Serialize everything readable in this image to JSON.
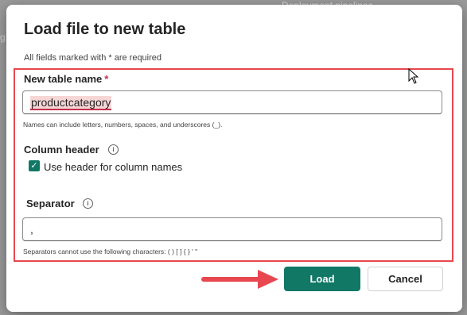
{
  "backdrop": {
    "text": "Deployment pipelines",
    "close": "✕",
    "letter": "g"
  },
  "dialog": {
    "title": "Load file to new table",
    "required_note": "All fields marked with * are required",
    "table_name": {
      "label": "New table name",
      "required_mark": "*",
      "value": "productcategory",
      "hint": "Names can include letters, numbers, spaces, and underscores (_)."
    },
    "column_header": {
      "label": "Column header",
      "info_icon": "info-icon",
      "checkbox_label": "Use header for column names",
      "checked": true
    },
    "separator": {
      "label": "Separator",
      "info_icon": "info-icon",
      "value": ",",
      "hint": "Separators cannot use the following characters: ( ) [ ] { } ' \""
    },
    "buttons": {
      "load": "Load",
      "cancel": "Cancel"
    }
  },
  "colors": {
    "accent": "#117865",
    "highlight": "#e8474f",
    "arrow": "#e8474f"
  }
}
